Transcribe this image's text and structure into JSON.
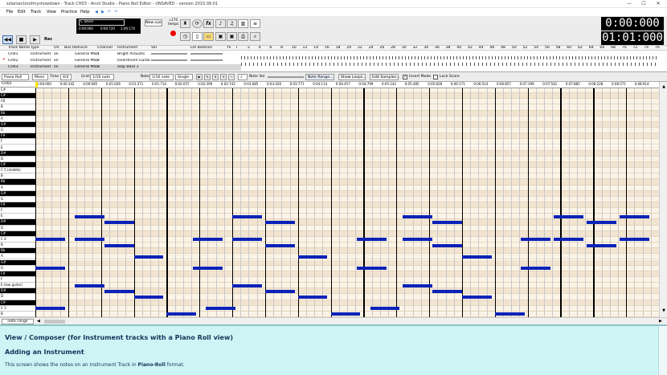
{
  "window": {
    "title": "solarsectorofmyshowdown - Track CH03 - Anvil Studio - Piano Roll Editor - UNSAVED - version 2015.09.01",
    "controls": {
      "minimize": "—",
      "maximize": "☐",
      "close": "✕"
    }
  },
  "menu": [
    "File",
    "Edit",
    "Track",
    "View",
    "Practice",
    "Help"
  ],
  "toolbar": {
    "cue_title": "C Shed",
    "cue_times": [
      "0:00:000",
      "0:00:720",
      "1:40:174"
    ],
    "new_cue": "New cue",
    "rec_label": "Rec",
    "tempo_label": "=170\ntempo",
    "time_top": "0:00:000",
    "time_bottom": "01:01:000"
  },
  "tracks": {
    "headers": [
      "Track Name",
      "Type",
      "On",
      "Bus 0",
      "Device",
      "Channel",
      "Instrument",
      "Vol",
      "L/R Balance",
      "fx",
      "T"
    ],
    "rows": [
      {
        "name": "CH01",
        "type": "Instrument",
        "on": "on",
        "device": "General MIDI",
        "channel": "1",
        "instrument": "Bright Acoustic"
      },
      {
        "name": "CH02",
        "type": "Instrument",
        "on": "on",
        "device": "General MIDI",
        "channel": "2",
        "instrument": "Overdriven Guitar"
      },
      {
        "name": "CH03",
        "type": "Instrument",
        "on": "on",
        "device": "General MIDI",
        "channel": "3",
        "instrument": "Slap Bass 1"
      }
    ],
    "measure_numbers": [
      "2",
      "4",
      "6",
      "8",
      "10",
      "12",
      "14",
      "16",
      "18",
      "20",
      "22",
      "24",
      "26",
      "28",
      "30",
      "32",
      "34",
      "36",
      "38",
      "40",
      "42",
      "44",
      "46",
      "48",
      "50",
      "52",
      "54",
      "56",
      "58",
      "60",
      "62",
      "64",
      "66",
      "68",
      "70",
      "72",
      "74",
      "76"
    ]
  },
  "piano_roll_controls": {
    "view": "Piano Roll",
    "mixer": "Mixer",
    "time_label": "Time",
    "time_sig": "4/4",
    "grid_label": "Grid:",
    "grid_value": "1/16 note",
    "note_label": "Note:",
    "note_value": "1/16 note",
    "single": "Single",
    "note_vol": "Note Vol",
    "note_range": "Note Range...",
    "show_loops": "Show Loops...",
    "edit_samples": "Edit Samples...",
    "insert_mode": "Insert Mode",
    "lock_score": "Lock Score"
  },
  "editor": {
    "track_label": "CH02",
    "ruler_times": [
      "0:00:000",
      "0:00:342",
      "0:00:685",
      "0:01:028",
      "0:01:371",
      "0:01:714",
      "0:02:057",
      "0:02:399",
      "0:02:742",
      "0:03:085",
      "0:03:428",
      "0:03:771",
      "0:04:114",
      "0:04:457",
      "0:04:799",
      "0:05:142",
      "0:05:485",
      "0:05:828",
      "0:06:171",
      "0:06:514",
      "0:06:857",
      "0:07:199",
      "0:07:542",
      "0:07:885",
      "0:08:228",
      "0:08:571",
      "0:08:914"
    ],
    "keys": [
      {
        "label": "C#",
        "black": false
      },
      {
        "label": "C#",
        "black": true
      },
      {
        "label": "C6",
        "black": false
      },
      {
        "label": "B",
        "black": false
      },
      {
        "label": "Bb",
        "black": true
      },
      {
        "label": "A",
        "black": false
      },
      {
        "label": "G#",
        "black": true
      },
      {
        "label": "G",
        "black": false
      },
      {
        "label": "F#",
        "black": true
      },
      {
        "label": "F",
        "black": false
      },
      {
        "label": "E",
        "black": false
      },
      {
        "label": "D#",
        "black": true
      },
      {
        "label": "D",
        "black": false
      },
      {
        "label": "C#",
        "black": true
      },
      {
        "label": "C 5 (middle)",
        "black": false
      },
      {
        "label": "B",
        "black": false
      },
      {
        "label": "Bb",
        "black": true
      },
      {
        "label": "A",
        "black": false
      },
      {
        "label": "G#",
        "black": true
      },
      {
        "label": "G",
        "black": false
      },
      {
        "label": "F#",
        "black": true
      },
      {
        "label": "F",
        "black": false
      },
      {
        "label": "E",
        "black": false
      },
      {
        "label": "D#",
        "black": true
      },
      {
        "label": "D",
        "black": false
      },
      {
        "label": "C#",
        "black": true
      },
      {
        "label": "C 4",
        "black": false
      },
      {
        "label": "B",
        "black": false
      },
      {
        "label": "Bb",
        "black": true
      },
      {
        "label": "A",
        "black": false
      },
      {
        "label": "G#",
        "black": true
      },
      {
        "label": "G",
        "black": false
      },
      {
        "label": "F#",
        "black": true
      },
      {
        "label": "F",
        "black": false
      },
      {
        "label": "E (low guitar)",
        "black": false
      },
      {
        "label": "D#",
        "black": true
      },
      {
        "label": "D",
        "black": false
      },
      {
        "label": "C#",
        "black": true
      },
      {
        "label": "C 3",
        "black": false
      },
      {
        "label": "B",
        "black": false
      }
    ],
    "notes": [
      {
        "row": 22,
        "start": 1.2,
        "len": 0.9
      },
      {
        "row": 23,
        "start": 2.1,
        "len": 0.9
      },
      {
        "row": 26,
        "start": 0.0,
        "len": 0.9
      },
      {
        "row": 26,
        "start": 1.2,
        "len": 0.9
      },
      {
        "row": 27,
        "start": 2.1,
        "len": 0.9
      },
      {
        "row": 29,
        "start": 3.0,
        "len": 0.9
      },
      {
        "row": 31,
        "start": 0.0,
        "len": 0.9
      },
      {
        "row": 34,
        "start": 1.2,
        "len": 0.9
      },
      {
        "row": 35,
        "start": 2.1,
        "len": 0.9
      },
      {
        "row": 36,
        "start": 3.0,
        "len": 0.9
      },
      {
        "row": 38,
        "start": 0.0,
        "len": 0.9
      },
      {
        "row": 39,
        "start": 4.0,
        "len": 0.9
      },
      {
        "row": 22,
        "start": 6.0,
        "len": 0.9
      },
      {
        "row": 23,
        "start": 7.0,
        "len": 0.9
      },
      {
        "row": 26,
        "start": 4.8,
        "len": 0.9
      },
      {
        "row": 26,
        "start": 6.0,
        "len": 0.9
      },
      {
        "row": 27,
        "start": 7.0,
        "len": 0.9
      },
      {
        "row": 29,
        "start": 8.0,
        "len": 0.9
      },
      {
        "row": 31,
        "start": 4.8,
        "len": 0.9
      },
      {
        "row": 34,
        "start": 6.0,
        "len": 0.9
      },
      {
        "row": 35,
        "start": 7.0,
        "len": 0.9
      },
      {
        "row": 36,
        "start": 8.0,
        "len": 0.9
      },
      {
        "row": 38,
        "start": 5.2,
        "len": 0.9
      },
      {
        "row": 39,
        "start": 9.0,
        "len": 0.9
      },
      {
        "row": 22,
        "start": 11.2,
        "len": 0.9
      },
      {
        "row": 23,
        "start": 12.1,
        "len": 0.9
      },
      {
        "row": 26,
        "start": 9.8,
        "len": 0.9
      },
      {
        "row": 26,
        "start": 11.2,
        "len": 0.9
      },
      {
        "row": 27,
        "start": 12.1,
        "len": 0.9
      },
      {
        "row": 29,
        "start": 13.0,
        "len": 0.9
      },
      {
        "row": 31,
        "start": 9.8,
        "len": 0.9
      },
      {
        "row": 34,
        "start": 11.2,
        "len": 0.9
      },
      {
        "row": 35,
        "start": 12.1,
        "len": 0.9
      },
      {
        "row": 36,
        "start": 13.0,
        "len": 0.9
      },
      {
        "row": 38,
        "start": 10.2,
        "len": 0.9
      },
      {
        "row": 39,
        "start": 14.0,
        "len": 0.9
      },
      {
        "row": 22,
        "start": 15.8,
        "len": 0.9
      },
      {
        "row": 23,
        "start": 16.8,
        "len": 0.9
      },
      {
        "row": 26,
        "start": 14.8,
        "len": 0.9
      },
      {
        "row": 26,
        "start": 15.8,
        "len": 0.9
      },
      {
        "row": 27,
        "start": 16.8,
        "len": 0.9
      },
      {
        "row": 31,
        "start": 14.8,
        "len": 0.9
      },
      {
        "row": 22,
        "start": 17.8,
        "len": 0.9
      },
      {
        "row": 26,
        "start": 17.8,
        "len": 0.9
      }
    ]
  },
  "bottom_tab": "note range",
  "help": {
    "heading": "View / Composer (for Instrument tracks with a Piano Roll view)",
    "subheading": "Adding an Instrument",
    "text_before": "This screen shows the notes on an Instrument Track in ",
    "text_bold": "Piano-Roll",
    "text_after": " format."
  },
  "colors": {
    "note": "#0b22b8",
    "help_bg": "#cdf5f5",
    "help_text": "#14325a",
    "lcd_bg": "#000000"
  }
}
